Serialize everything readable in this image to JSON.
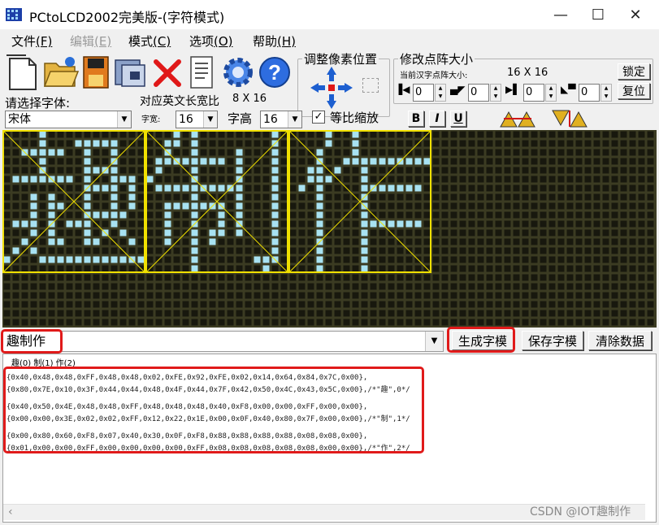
{
  "window": {
    "title": "PCtoLCD2002完美版-(字符模式)",
    "minimize": "—",
    "maximize": "☐",
    "close": "✕"
  },
  "menu": [
    {
      "label": "文件",
      "key": "(F)",
      "enabled": true
    },
    {
      "label": "编辑",
      "key": "(E)",
      "enabled": false
    },
    {
      "label": "模式",
      "key": "(C)",
      "enabled": true
    },
    {
      "label": "选项",
      "key": "(O)",
      "enabled": true
    },
    {
      "label": "帮助",
      "key": "(H)",
      "enabled": true
    }
  ],
  "toolbar": {
    "font_prompt": "请选择字体:",
    "font_value": "宋体",
    "english_ratio_label": "对应英文长宽比",
    "english_ratio_value": "8 X 16",
    "char_width_label": "字宽:",
    "char_width_value": "16",
    "char_height_label": "字高",
    "char_height_value": "16",
    "proportional_label": "等比缩放",
    "proportional_checked": true,
    "bold": "B",
    "italic": "I",
    "underline": "U",
    "pixel_adjust_title": "调整像素位置",
    "matrix_size_title": "修改点阵大小",
    "current_size_label": "当前汉字点阵大小:",
    "current_size_value": "16 X 16",
    "lock_button": "锁定",
    "reset_button": "复位",
    "spin_values": [
      "0",
      "0",
      "0",
      "0"
    ]
  },
  "input": {
    "text": "趣制作",
    "generate_button": "生成字模",
    "save_button": "保存字模",
    "clear_button": "清除数据"
  },
  "output": {
    "tabs": "趣(0)  制(1)  作(2)",
    "lines": [
      "{0x40,0x48,0x48,0xFF,0x48,0x48,0x02,0xFE,0x92,0xFE,0x02,0x14,0x64,0x84,0x7C,0x00},",
      "{0x80,0x7E,0x10,0x3F,0x44,0x44,0x48,0x4F,0x44,0x7F,0x42,0x50,0x4C,0x43,0x5C,0x00},/*\"趣\",0*/",
      "",
      "{0x40,0x50,0x4E,0x48,0x48,0xFF,0x48,0x48,0x48,0x40,0xF8,0x00,0x00,0xFF,0x00,0x00},",
      "{0x00,0x00,0x3E,0x02,0x02,0xFF,0x12,0x22,0x1E,0x00,0x0F,0x40,0x80,0x7F,0x00,0x00},/*\"制\",1*/",
      "",
      "{0x00,0x80,0x60,0xF8,0x07,0x40,0x30,0x0F,0xF8,0x88,0x88,0x88,0x88,0x08,0x08,0x00},",
      "{0x01,0x00,0x00,0xFF,0x00,0x00,0x00,0x00,0xFF,0x08,0x08,0x08,0x08,0x08,0x00,0x00},/*\"作\",2*/"
    ]
  },
  "watermark": "CSDN @IOT趣制作",
  "colors": {
    "grid_bg": "#3b3b22",
    "grid_off": "#18180e",
    "grid_on": "#a8e2f2",
    "char_border": "#f0e000",
    "highlight": "#e01a1a"
  },
  "glyphs": [
    {
      "char": "趣",
      "rows": [
        "0000100000000000",
        "0000100011111000",
        "0011111001001000",
        "0000100001001000",
        "0000100001111000",
        "0111111101001110",
        "0000000001111010",
        "0001010001001010",
        "0001011001001010",
        "0001010001111100",
        "0111010111001000",
        "0001010001010100",
        "0010011001100010",
        "0101000000000000",
        "1000111111111111",
        "0000000000000000"
      ]
    },
    {
      "char": "制",
      "rows": [
        "0001010000000010",
        "0011010000000010",
        "0010010000100010",
        "0111111110100010",
        "0100010000100010",
        "1000010000100010",
        "0111111111100010",
        "0000010000100010",
        "0011111110100010",
        "0010010010100010",
        "0010010010100010",
        "0010010110100010",
        "0010010100000010",
        "0000010000000010",
        "0000010000001110",
        "0000010000000100"
      ]
    },
    {
      "char": "作",
      "rows": [
        "0000100100000000",
        "0000100100000000",
        "0001000100000000",
        "0001001111111111",
        "0011010010000000",
        "0011100010000000",
        "0101000011111110",
        "0001000010000000",
        "0001000010000000",
        "0001000010000000",
        "0001000011111110",
        "0001000010000000",
        "0001000010000000",
        "0001000010000000",
        "0001000010000000",
        "0001000010000000"
      ]
    }
  ]
}
